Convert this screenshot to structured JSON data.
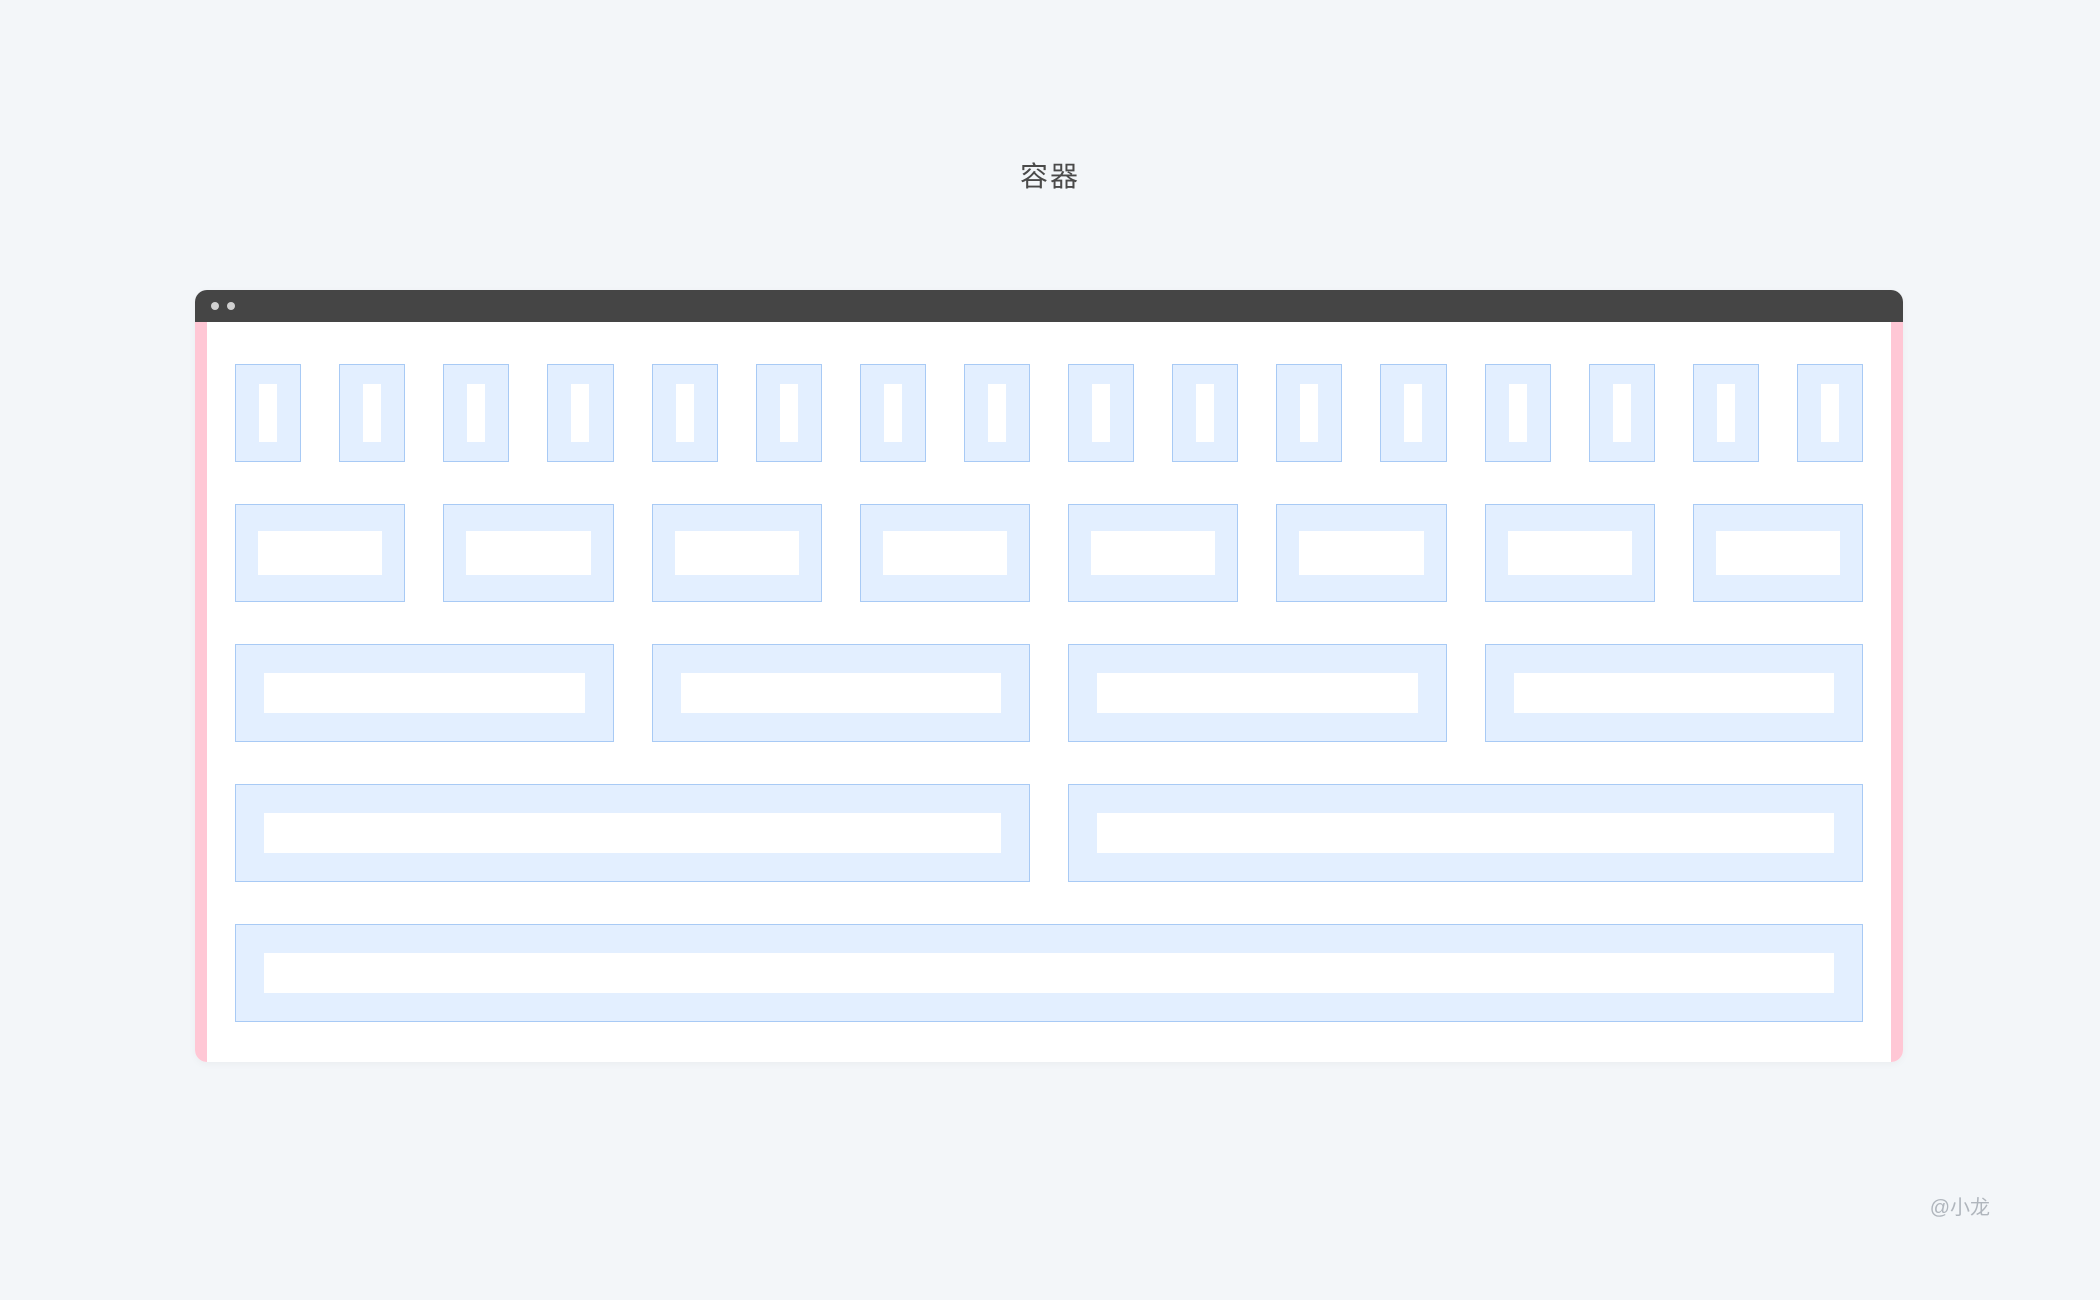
{
  "title": "容器",
  "attribution": "@小龙",
  "window": {
    "rows": [
      {
        "cols": 16
      },
      {
        "cols": 8
      },
      {
        "cols": 4
      },
      {
        "cols": 2
      },
      {
        "cols": 1
      }
    ]
  },
  "colors": {
    "page_bg": "#f3f6f9",
    "title_bar": "#454545",
    "container_border": "#ffc7d5",
    "cell_fill": "#e3efff",
    "cell_border": "#a8caf5",
    "cell_inner": "#ffffff"
  }
}
